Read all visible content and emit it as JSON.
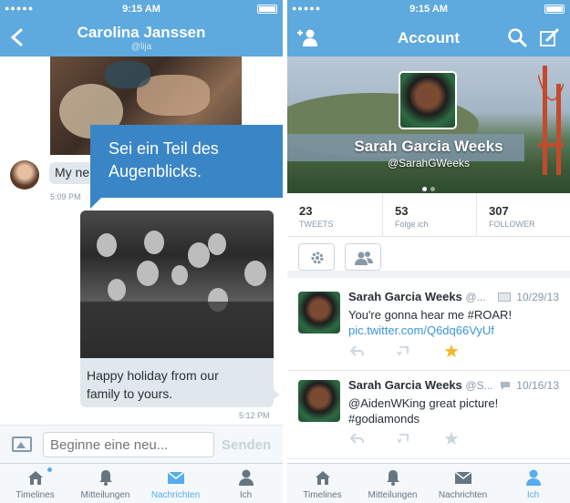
{
  "status": {
    "time": "9:15 AM",
    "signal": "●●●●●"
  },
  "chat": {
    "title": "Carolina Janssen",
    "handle": "@lija",
    "incoming_text": "My ne",
    "incoming_time": "5:09 PM",
    "callout_line1": "Sei ein Teil des",
    "callout_line2": "Augenblicks.",
    "outgoing_line1": "Happy holiday from our",
    "outgoing_line2": "family to yours.",
    "outgoing_time": "5:12 PM",
    "input_placeholder": "Beginne eine neu...",
    "send_label": "Senden"
  },
  "tabs": [
    {
      "label": "Timelines"
    },
    {
      "label": "Mitteilungen"
    },
    {
      "label": "Nachrichten"
    },
    {
      "label": "Ich"
    }
  ],
  "account": {
    "title": "Account",
    "name": "Sarah Garcia Weeks",
    "handle": "@SarahGWeeks",
    "stats": [
      {
        "value": "23",
        "label": "TWEETS"
      },
      {
        "value": "53",
        "label": "Folge ich"
      },
      {
        "value": "307",
        "label": "FOLLOWER"
      }
    ]
  },
  "tweets": [
    {
      "name": "Sarah Garcia Weeks",
      "handle": "@...",
      "date": "10/29/13",
      "text": "You're gonna hear me #ROAR!",
      "link": "pic.twitter.com/Q6dq66VyUf",
      "favorited": true
    },
    {
      "name": "Sarah Garcia Weeks",
      "handle": "@S...",
      "date": "10/16/13",
      "text_line1": "@AidenWKing great picture!",
      "text_line2": "#godiamonds",
      "favorited": false
    }
  ],
  "colors": {
    "brand": "#5ea9dd",
    "callout": "#3a85c6",
    "link": "#3b94d9",
    "star": "#f5b82e"
  }
}
